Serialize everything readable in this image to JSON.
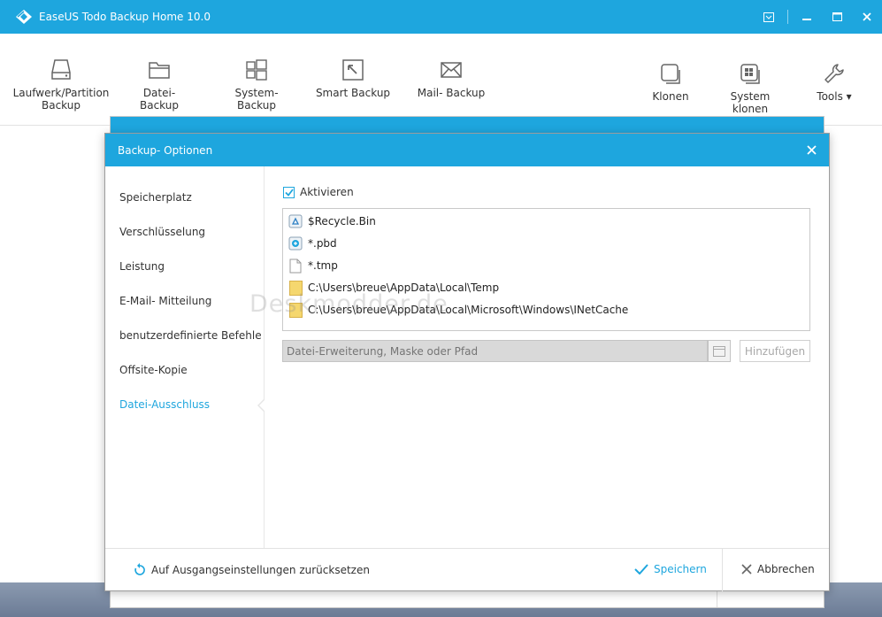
{
  "app": {
    "title": "EaseUS Todo Backup Home 10.0"
  },
  "toolbar": {
    "left_tools": [
      {
        "label": "Laufwerk/Partition\nBackup",
        "icon": "drive-icon"
      },
      {
        "label": "Datei- Backup",
        "icon": "folder-icon"
      },
      {
        "label": "System- Backup",
        "icon": "windows-icon"
      },
      {
        "label": "Smart Backup",
        "icon": "smart-arrow-icon"
      },
      {
        "label": "Mail- Backup",
        "icon": "mail-icon"
      }
    ],
    "right_tools": [
      {
        "label": "Klonen",
        "icon": "clone-icon"
      },
      {
        "label": "System klonen",
        "icon": "system-clone-icon"
      },
      {
        "label": "Tools ▾",
        "icon": "wrench-icon"
      }
    ]
  },
  "dialog": {
    "title": "Backup- Optionen",
    "sidebar": [
      "Speicherplatz",
      "Verschlüsselung",
      "Leistung",
      "E-Mail- Mitteilung",
      "benutzerdefinierte Befehle",
      "Offsite-Kopie",
      "Datei-Ausschluss"
    ],
    "active_item": "Datei-Ausschluss",
    "activate_label": "Aktivieren",
    "activate_checked": true,
    "exclusions": [
      {
        "text": "$Recycle.Bin",
        "icon": "recycle-bin-icon"
      },
      {
        "text": "*.pbd",
        "icon": "pbd-file-icon"
      },
      {
        "text": "*.tmp",
        "icon": "blank-file-icon"
      },
      {
        "text": "C:\\Users\\breue\\AppData\\Local\\Temp",
        "icon": "folder-icon"
      },
      {
        "text": "C:\\Users\\breue\\AppData\\Local\\Microsoft\\Windows\\INetCache",
        "icon": "folder-icon"
      }
    ],
    "path_placeholder": "Datei-Erweiterung, Maske oder Pfad",
    "add_label": "Hinzufügen",
    "reset_label": "Auf Ausgangseinstellungen zurücksetzen",
    "save_label": "Speichern",
    "cancel_label": "Abbrechen"
  },
  "watermark": "Deskmodder.de",
  "colors": {
    "accent": "#1ea6de",
    "folder": "#f5d76e"
  }
}
